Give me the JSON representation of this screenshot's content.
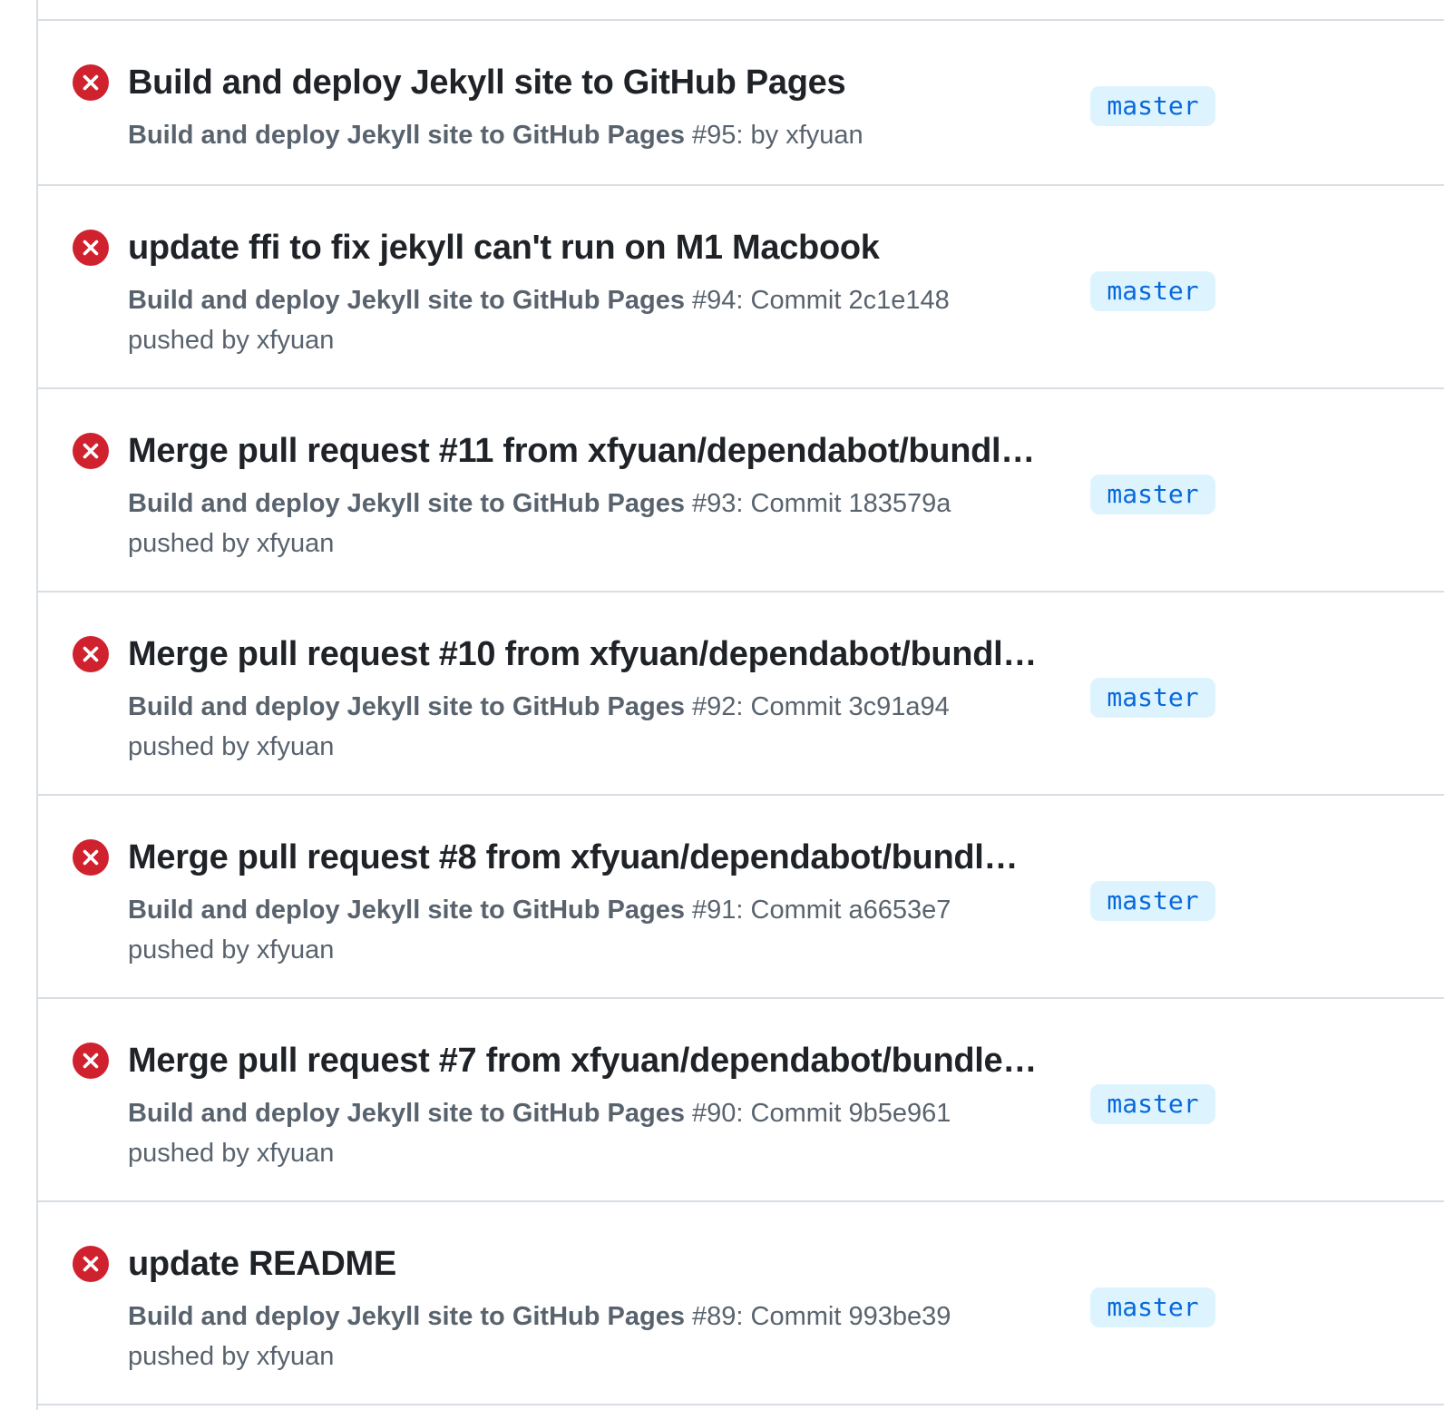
{
  "colors": {
    "failure": "#cf222e",
    "branch_bg": "#ddf4ff",
    "branch_text": "#0969da",
    "title_text": "#1f2328",
    "meta_text": "#59636e",
    "divider": "#d8dee4"
  },
  "runs": [
    {
      "status_icon": "x-circle-fill-icon",
      "title": "Build and deploy Jekyll site to GitHub Pages",
      "workflow": "Build and deploy Jekyll site to GitHub Pages",
      "detail": " #95: by xfyuan",
      "detail2": "",
      "branch": "master"
    },
    {
      "status_icon": "x-circle-fill-icon",
      "title": "update ffi to fix jekyll can't run on M1 Macbook",
      "workflow": "Build and deploy Jekyll site to GitHub Pages",
      "detail": " #94: Commit 2c1e148",
      "detail2": "pushed by xfyuan",
      "branch": "master"
    },
    {
      "status_icon": "x-circle-fill-icon",
      "title": "Merge pull request #11 from xfyuan/dependabot/bundl…",
      "workflow": "Build and deploy Jekyll site to GitHub Pages",
      "detail": " #93: Commit 183579a",
      "detail2": "pushed by xfyuan",
      "branch": "master"
    },
    {
      "status_icon": "x-circle-fill-icon",
      "title": "Merge pull request #10 from xfyuan/dependabot/bundl…",
      "workflow": "Build and deploy Jekyll site to GitHub Pages",
      "detail": " #92: Commit 3c91a94",
      "detail2": "pushed by xfyuan",
      "branch": "master"
    },
    {
      "status_icon": "x-circle-fill-icon",
      "title": "Merge pull request #8 from xfyuan/dependabot/bundl…",
      "workflow": "Build and deploy Jekyll site to GitHub Pages",
      "detail": " #91: Commit a6653e7",
      "detail2": "pushed by xfyuan",
      "branch": "master"
    },
    {
      "status_icon": "x-circle-fill-icon",
      "title": "Merge pull request #7 from xfyuan/dependabot/bundle…",
      "workflow": "Build and deploy Jekyll site to GitHub Pages",
      "detail": " #90: Commit 9b5e961",
      "detail2": "pushed by xfyuan",
      "branch": "master"
    },
    {
      "status_icon": "x-circle-fill-icon",
      "title": "update README",
      "workflow": "Build and deploy Jekyll site to GitHub Pages",
      "detail": " #89: Commit 993be39",
      "detail2": "pushed by xfyuan",
      "branch": "master"
    }
  ]
}
